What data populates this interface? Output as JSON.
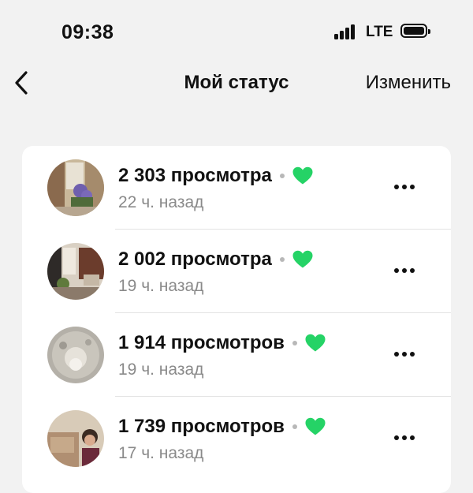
{
  "status_bar": {
    "time": "09:38",
    "network": "LTE",
    "icons": [
      "signal-icon",
      "battery-icon"
    ]
  },
  "nav": {
    "back_icon": "chevron-left-icon",
    "title": "Мой статус",
    "edit_label": "Изменить"
  },
  "colors": {
    "background": "#f2f2f2",
    "card": "#ffffff",
    "heart": "#25d366",
    "secondary_text": "#8a8a8a"
  },
  "statuses": [
    {
      "views": "2 303 просмотра",
      "time_ago": "22 ч. назад",
      "liked": true,
      "heart_icon": "heart-icon",
      "more_icon": "more-icon"
    },
    {
      "views": "2 002 просмотра",
      "time_ago": "19 ч. назад",
      "liked": true,
      "heart_icon": "heart-icon",
      "more_icon": "more-icon"
    },
    {
      "views": "1 914 просмотров",
      "time_ago": "19 ч. назад",
      "liked": true,
      "heart_icon": "heart-icon",
      "more_icon": "more-icon"
    },
    {
      "views": "1 739 просмотров",
      "time_ago": "17 ч. назад",
      "liked": true,
      "heart_icon": "heart-icon",
      "more_icon": "more-icon"
    }
  ]
}
